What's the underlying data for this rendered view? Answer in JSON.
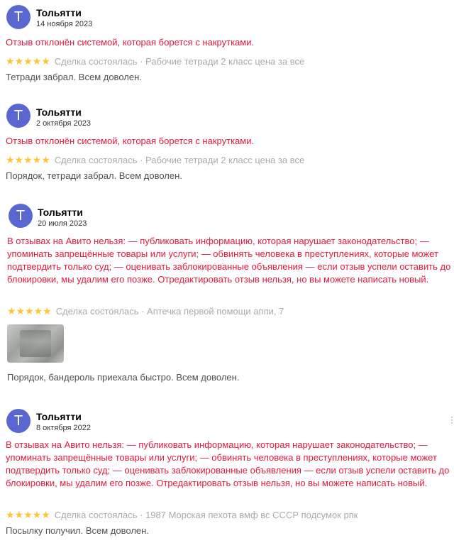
{
  "reviews": [
    {
      "avatar_letter": "Т",
      "author": "Тольятти",
      "date": "14 ноября 2023",
      "status": "Отзыв отклонён системой, которая борется с накрутками.",
      "rating_stars": "★★★★★",
      "rating": 5,
      "meta": "Сделка состоялась · Рабочие тетради 2 класс цена за все",
      "text": "Тетради забрал. Всем доволен."
    },
    {
      "avatar_letter": "Т",
      "author": "Тольятти",
      "date": "2 октября 2023",
      "status": "Отзыв отклонён системой, которая борется с накрутками.",
      "rating_stars": "★★★★★",
      "rating": 5,
      "meta": "Сделка состоялась · Рабочие тетради 2 класс цена за все",
      "text": "Порядок, тетради забрал. Всем доволен."
    },
    {
      "avatar_letter": "Т",
      "author": "Тольятти",
      "date": "20 июля 2023",
      "status": "В отзывах на Авито нельзя: — публиковать информацию, которая нарушает законодательство; — упоминать запрещённые товары или услуги; — обвинять человека в преступлениях, которые может подтвердить только суд; — оценивать заблокированные объявления — если отзыв успели оставить до блокировки, мы удалим его позже. Отредактировать отзыв нельзя, но вы можете написать новый.",
      "rating_stars": "★★★★★",
      "rating": 5,
      "meta": "Сделка состоялась · Аптечка первой помощи аппи, 7",
      "text": "Порядок, бандероль приехала быстро. Всем доволен."
    },
    {
      "avatar_letter": "Т",
      "author": "Тольятти",
      "date": "8 октября 2022",
      "status": "В отзывах на Авито нельзя: — публиковать информацию, которая нарушает законодательство; — упоминать запрещённые товары или услуги; — обвинять человека в преступлениях, которые может подтвердить только суд; — оценивать заблокированные объявления — если отзыв успели оставить до блокировки, мы удалим его позже. Отредактировать отзыв нельзя, но вы можете написать новый.",
      "rating_stars": "★★★★★",
      "rating": 5,
      "meta": "Сделка состоялась · 1987 Морская пехота вмф вс СССР подсумок рпк",
      "text": "Посылку получил. Всем доволен."
    }
  ],
  "colors": {
    "avatar": "#5a67d0",
    "error": "#e4193c",
    "star": "#fcc735",
    "meta": "#aaaaaa"
  },
  "icons": {
    "more": "vertical-dots-icon"
  }
}
